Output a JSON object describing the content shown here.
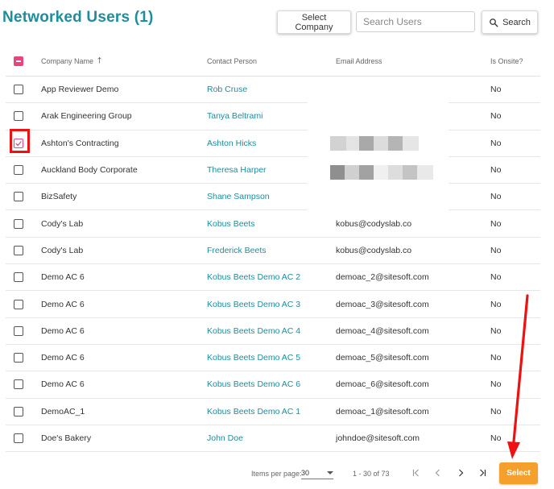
{
  "header": {
    "title": "Networked Users (1)",
    "select_company_label": "Select Company",
    "search_placeholder": "Search Users",
    "search_label": "Search"
  },
  "table": {
    "columns": {
      "company": "Company Name",
      "contact": "Contact Person",
      "email": "Email Address",
      "onsite": "Is Onsite?"
    },
    "sort": {
      "column": "company",
      "direction": "ascending"
    },
    "rows": [
      {
        "company": "App Reviewer Demo",
        "contact": "Rob Cruse",
        "email": "",
        "onsite": "No",
        "checked": false
      },
      {
        "company": "Arak Engineering Group",
        "contact": "Tanya Beltrami",
        "email": "",
        "onsite": "No",
        "checked": false
      },
      {
        "company": "Ashton's Contracting",
        "contact": "Ashton Hicks",
        "email": "",
        "onsite": "No",
        "checked": true
      },
      {
        "company": "Auckland Body Corporate",
        "contact": "Theresa Harper",
        "email": "",
        "onsite": "No",
        "checked": false
      },
      {
        "company": "BizSafety",
        "contact": "Shane Sampson",
        "email": "",
        "onsite": "No",
        "checked": false
      },
      {
        "company": "Cody's Lab",
        "contact": "Kobus Beets",
        "email": "kobus@codyslab.co",
        "onsite": "No",
        "checked": false
      },
      {
        "company": "Cody's Lab",
        "contact": "Frederick Beets",
        "email": "kobus@codyslab.co",
        "onsite": "No",
        "checked": false
      },
      {
        "company": "Demo AC 6",
        "contact": "Kobus Beets Demo AC 2",
        "email": "demoac_2@sitesoft.com",
        "onsite": "No",
        "checked": false
      },
      {
        "company": "Demo AC 6",
        "contact": "Kobus Beets Demo AC 3",
        "email": "demoac_3@sitesoft.com",
        "onsite": "No",
        "checked": false
      },
      {
        "company": "Demo AC 6",
        "contact": "Kobus Beets Demo AC 4",
        "email": "demoac_4@sitesoft.com",
        "onsite": "No",
        "checked": false
      },
      {
        "company": "Demo AC 6",
        "contact": "Kobus Beets Demo AC 5",
        "email": "demoac_5@sitesoft.com",
        "onsite": "No",
        "checked": false
      },
      {
        "company": "Demo AC 6",
        "contact": "Kobus Beets Demo AC 6",
        "email": "demoac_6@sitesoft.com",
        "onsite": "No",
        "checked": false
      },
      {
        "company": "DemoAC_1",
        "contact": "Kobus Beets Demo AC 1",
        "email": "demoac_1@sitesoft.com",
        "onsite": "No",
        "checked": false
      },
      {
        "company": "Doe's Bakery",
        "contact": "John Doe",
        "email": "johndoe@sitesoft.com",
        "onsite": "No",
        "checked": false
      }
    ]
  },
  "footer": {
    "items_per_page_label": "Items per page:",
    "items_per_page_value": "30",
    "range_label": "1 - 30 of 73",
    "select_label": "Select"
  },
  "colors": {
    "accent": "#1e8d9c",
    "checkbox": "#e8457a",
    "select_button": "#f5a02c",
    "annotation": "#ee1111"
  },
  "icons": {
    "search": "search-icon",
    "sort": "arrow-up-icon",
    "first_page": "first-page-icon",
    "prev_page": "chevron-left-icon",
    "next_page": "chevron-right-icon",
    "last_page": "last-page-icon"
  }
}
